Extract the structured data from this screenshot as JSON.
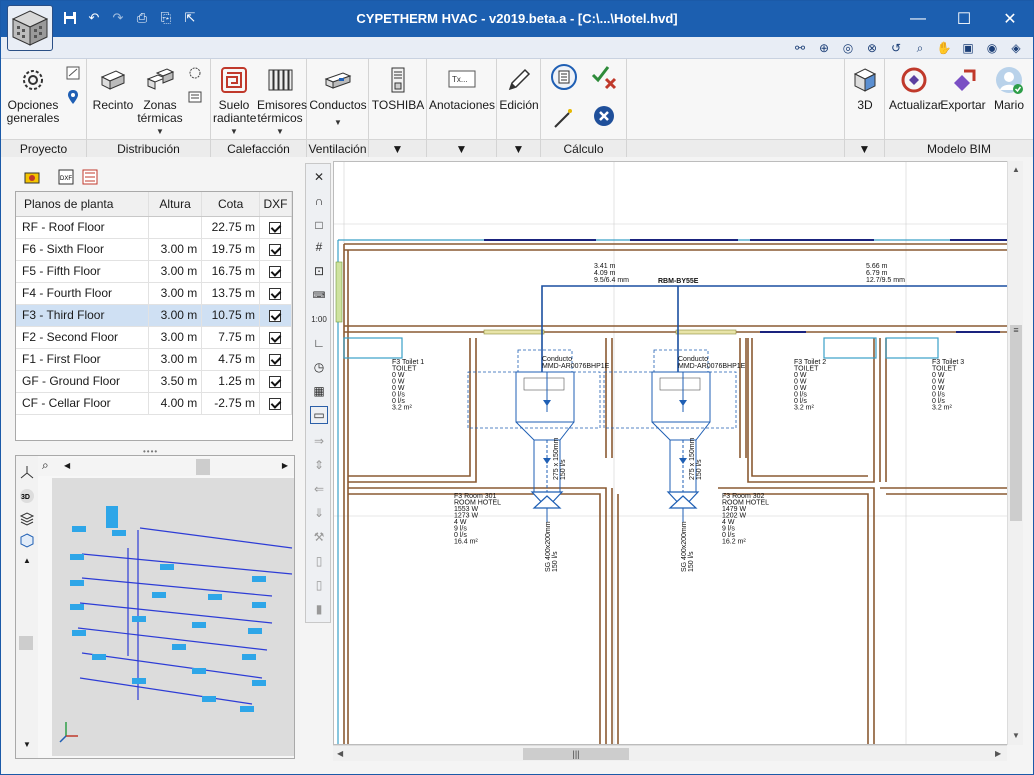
{
  "titlebar": {
    "title": "CYPETHERM HVAC - v2019.beta.a - [C:\\...\\Hotel.hvd]",
    "minimize": "—",
    "maximize": "☐",
    "close": "✕"
  },
  "ribbon": {
    "groups": {
      "proyecto": "Proyecto",
      "distribucion": "Distribución",
      "calefaccion": "Calefacción",
      "ventilacion": "Ventilación",
      "calculo": "Cálculo",
      "modelo_bim": "Modelo BIM"
    },
    "buttons": {
      "opciones_1": "Opciones",
      "opciones_2": "generales",
      "recinto": "Recinto",
      "zonas_1": "Zonas",
      "zonas_2": "térmicas",
      "suelo_1": "Suelo",
      "suelo_2": "radiante",
      "emisores_1": "Emisores",
      "emisores_2": "térmicos",
      "conductos": "Conductos",
      "toshiba": "TOSHIBA",
      "anotaciones": "Anotaciones",
      "edicion": "Edición",
      "tres_d": "3D",
      "actualizar": "Actualizar",
      "exportar": "Exportar",
      "mario": "Mario"
    }
  },
  "floors": {
    "headers": [
      "Planos de planta",
      "Altura",
      "Cota",
      "DXF"
    ],
    "rows": [
      {
        "name": "RF - Roof Floor",
        "altura": "",
        "cota": "22.75 m",
        "dxf": true
      },
      {
        "name": "F6 - Sixth Floor",
        "altura": "3.00 m",
        "cota": "19.75 m",
        "dxf": true
      },
      {
        "name": "F5 - Fifth Floor",
        "altura": "3.00 m",
        "cota": "16.75 m",
        "dxf": true
      },
      {
        "name": "F4 - Fourth Floor",
        "altura": "3.00 m",
        "cota": "13.75 m",
        "dxf": true
      },
      {
        "name": "F3 - Third Floor",
        "altura": "3.00 m",
        "cota": "10.75 m",
        "dxf": true,
        "selected": true
      },
      {
        "name": "F2 - Second Floor",
        "altura": "3.00 m",
        "cota": "7.75 m",
        "dxf": true
      },
      {
        "name": "F1 - First Floor",
        "altura": "3.00 m",
        "cota": "4.75 m",
        "dxf": true
      },
      {
        "name": "GF - Ground Floor",
        "altura": "3.50 m",
        "cota": "1.25 m",
        "dxf": true
      },
      {
        "name": "CF - Cellar Floor",
        "altura": "4.00 m",
        "cota": "-2.75 m",
        "dxf": true
      }
    ]
  },
  "plan": {
    "dim_left_1": "3.41 m",
    "dim_left_2": "4.09 m",
    "dim_left_3": "9.5/6.4 mm",
    "dim_right_1": "5.66 m",
    "dim_right_2": "6.79 m",
    "dim_right_3": "12.7/9.5 mm",
    "unit_label": "RBM-BY55E",
    "duct_1": "Conducto",
    "duct_1_model": "MMD-AR0076BHP1E",
    "duct_2": "Conducto",
    "duct_2_model": "MMD-AR0076BHP1E",
    "toilet1": [
      "F3 Toilet 1",
      "TOILET",
      "0 W",
      "0 W",
      "0 W",
      "0 l/s",
      "0 l/s",
      "3.2 m²"
    ],
    "toilet2": [
      "F3 Toilet 2",
      "TOILET",
      "0 W",
      "0 W",
      "0 W",
      "0 l/s",
      "0 l/s",
      "3.2 m²"
    ],
    "toilet3": [
      "F3 Toilet 3",
      "TOILET",
      "0 W",
      "0 W",
      "0 W",
      "0 l/s",
      "0 l/s",
      "3.2 m²"
    ],
    "room301": [
      "F3 Room 301",
      "ROOM HOTEL",
      "1553 W",
      "1273 W",
      "4 W",
      "9 l/s",
      "0 l/s",
      "16.4 m²"
    ],
    "room302": [
      "F3 Room 302",
      "ROOM HOTEL",
      "1479 W",
      "1202 W",
      "4 W",
      "9 l/s",
      "0 l/s",
      "16.2 m²"
    ],
    "duct_size_1": "275 x 150mm",
    "duct_flow_1": "150 l/s",
    "duct_size_2": "275 x 150mm",
    "duct_flow_2": "150 l/s",
    "grille_1": "SG 400x200mm",
    "grille_1b": "150 l/s",
    "grille_2": "SG 400x200mm",
    "grille_2b": "150 l/s"
  },
  "colors": {
    "titlebar": "#1c5fb0",
    "wall": "#8a5a32",
    "pipe": "#1a4fa0",
    "duct": "#1f5fb4",
    "selection": "#cfe0f3"
  }
}
